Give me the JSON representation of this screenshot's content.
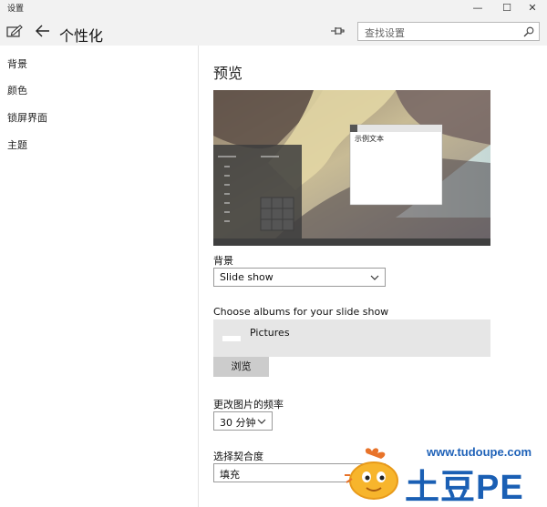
{
  "window": {
    "title": "设置",
    "min_glyph": "—",
    "max_glyph": "☐",
    "close_glyph": "✕"
  },
  "header": {
    "title": "个性化",
    "search_placeholder": "查找设置"
  },
  "sidebar": {
    "items": [
      {
        "label": "背景"
      },
      {
        "label": "颜色"
      },
      {
        "label": "锁屏界面"
      },
      {
        "label": "主题"
      }
    ]
  },
  "main": {
    "preview_title": "预览",
    "preview_window_text": "示例文本",
    "background_label": "背景",
    "background_value": "Slide show",
    "albums_label": "Choose albums for your slide show",
    "album_name": "Pictures",
    "browse_button": "浏览",
    "frequency_label": "更改图片的频率",
    "frequency_value": "30 分钟",
    "fit_label": "选择契合度",
    "fit_value": "填充"
  },
  "watermark": {
    "url": "www.tudoupe.com",
    "brand": "土豆PE"
  },
  "icons": [
    "edit-icon",
    "back-arrow-icon",
    "pin-icon",
    "search-icon",
    "chevron-down-icon",
    "minimize-icon",
    "maximize-icon",
    "close-icon"
  ],
  "colors": {
    "chrome": "#f2f2f2",
    "album_bg": "#e6e6e6",
    "button_bg": "#cccccc",
    "watermark_blue": "#1a5fb4"
  }
}
